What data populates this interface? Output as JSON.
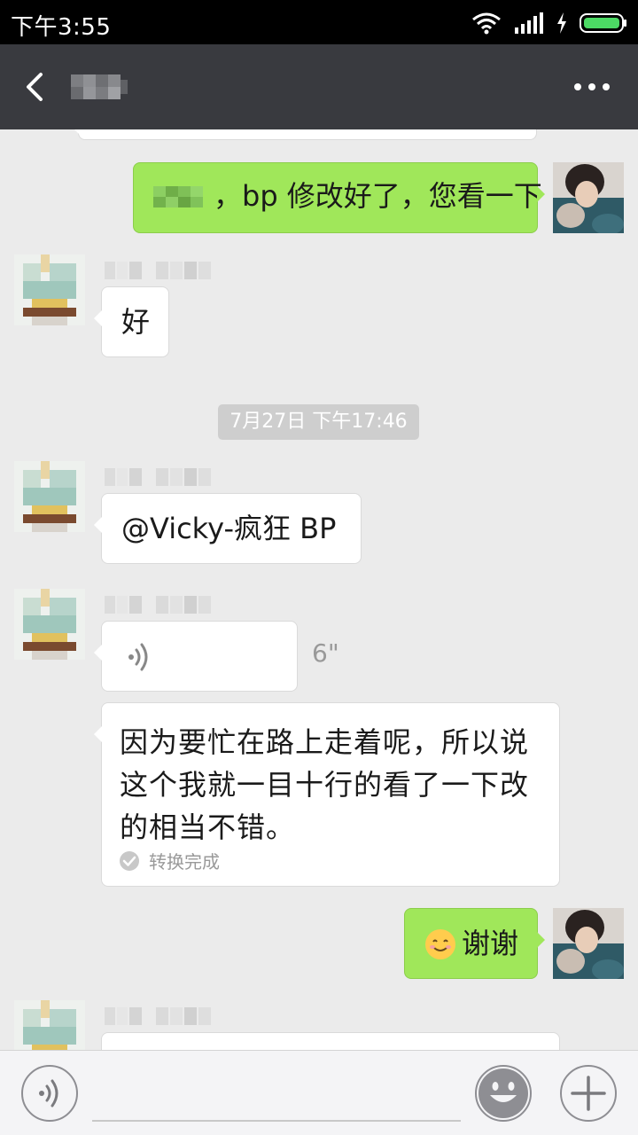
{
  "status_bar": {
    "time": "下午3:55"
  },
  "nav": {
    "title": "",
    "back_icon": "back-arrow-icon",
    "more_icon": "more-dots-icon"
  },
  "messages": {
    "sent_1": "，bp 修改好了，您看一下",
    "recv_1": "好",
    "timestamp": "7月27日 下午17:46",
    "recv_2": "@Vicky-疯狂 BP",
    "voice_duration": "6\"",
    "transcript": "因为要忙在路上走着呢，所以说这个我就一目十行的看了一下改的相当不错。",
    "transcript_status": "转换完成",
    "sent_2": "谢谢"
  },
  "colors": {
    "sent_bubble": "#a0e75a",
    "received_bubble": "#ffffff",
    "nav_bar": "#393a3f",
    "chat_bg": "#ebebeb"
  }
}
